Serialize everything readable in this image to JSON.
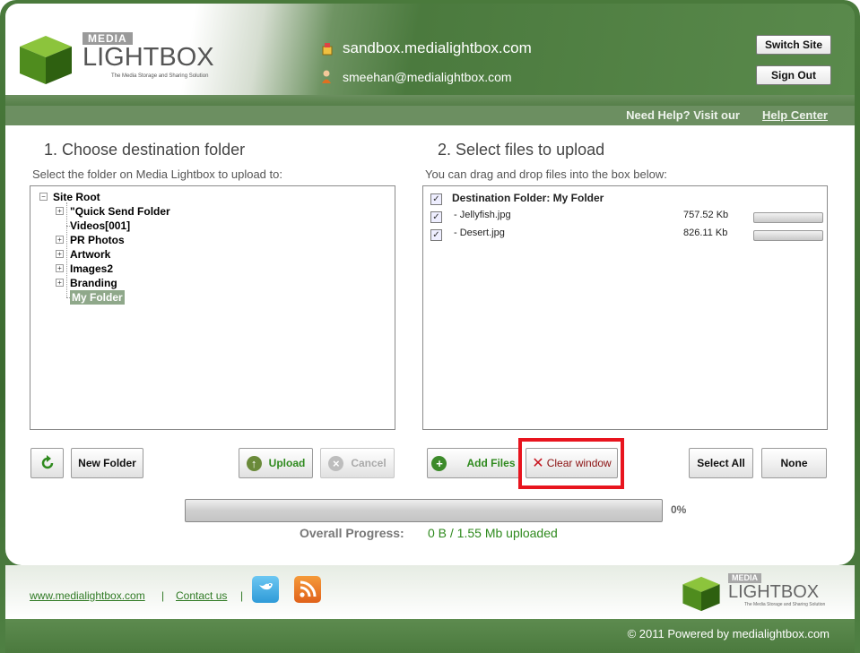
{
  "header": {
    "logo": {
      "media_tag": "MEDIA",
      "wordmark": "LIGHTBOX",
      "tagline": "The Media Storage and Sharing Solution"
    },
    "site": "sandbox.medialightbox.com",
    "user": "smeehan@medialightbox.com",
    "switch_site_label": "Switch Site",
    "sign_out_label": "Sign Out",
    "help_text": "Need Help? Visit our",
    "help_link": "Help Center"
  },
  "left": {
    "title": "1. Choose destination folder",
    "subtitle": "Select the folder on Media Lightbox to upload to:",
    "tree": {
      "root": "Site Root",
      "items": [
        "\"Quick Send Folder",
        "Videos[001]",
        "PR Photos",
        "Artwork",
        "Images2",
        "Branding",
        "My Folder"
      ],
      "selected": "My Folder"
    },
    "new_folder_label": "New Folder",
    "upload_label": "Upload",
    "cancel_label": "Cancel"
  },
  "right": {
    "title": "2. Select files to upload",
    "subtitle": "You can drag and drop files into the box below:",
    "destination": "Destination Folder: My Folder",
    "files": [
      {
        "name": "- Jellyfish.jpg",
        "size": "757.52 Kb",
        "checked": true,
        "progress": 0
      },
      {
        "name": "- Desert.jpg",
        "size": "826.11 Kb",
        "checked": true,
        "progress": 0
      }
    ],
    "add_files_label": "Add Files",
    "clear_window_label": "Clear window",
    "select_all_label": "Select All",
    "none_label": "None"
  },
  "progress": {
    "percent_text": "0%",
    "percent": 0,
    "label": "Overall Progress:",
    "value": "0 B / 1.55 Mb uploaded"
  },
  "footer": {
    "website_link": "www.medialightbox.com",
    "separator": "|",
    "contact_link": "Contact us",
    "logo": {
      "media_tag": "MEDIA",
      "wordmark": "LIGHTBOX",
      "tagline": "The Media Storage and Sharing Solution"
    },
    "copyright": "© 2011 Powered by medialightbox.com"
  },
  "colors": {
    "brand_green": "#4b7a3e",
    "link_green": "#2f7a24",
    "highlight_red": "#e8141e"
  }
}
